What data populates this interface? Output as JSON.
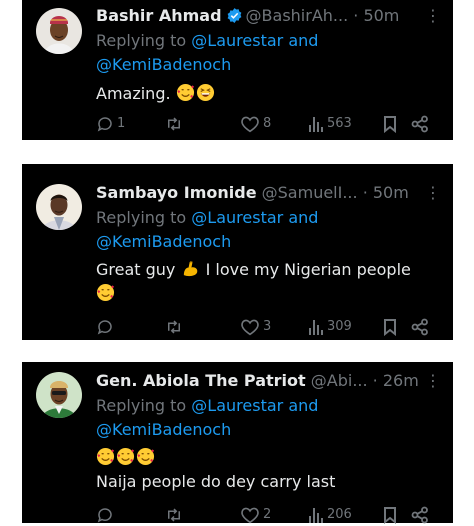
{
  "tweets": [
    {
      "name": "Bashir Ahmad",
      "verified": true,
      "handle": "@BashirAh...",
      "time": "· 50m",
      "replying_prefix": "Replying to",
      "replying_to_1": "@Laurestar",
      "replying_and": "and",
      "replying_to_2": "@KemiBadenoch",
      "text_line_1": "Amazing.",
      "emoji_line_1": [
        "smiling-face-with-hearts",
        "grinning-squinting-face"
      ],
      "replies": "1",
      "retweets": "",
      "likes": "8",
      "views": "563"
    },
    {
      "name": "Sambayo Imonide",
      "verified": false,
      "handle": "@SamuelI...",
      "time": "· 50m",
      "replying_prefix": "Replying to",
      "replying_to_1": "@Laurestar",
      "replying_and": "and",
      "replying_to_2": "@KemiBadenoch",
      "text_line_1a": "Great guy",
      "text_line_1b": "I love my Nigerian people",
      "emoji_line_1": [
        "flexed-biceps"
      ],
      "emoji_line_2": [
        "smiling-face-with-hearts"
      ],
      "replies": "",
      "retweets": "",
      "likes": "3",
      "views": "309"
    },
    {
      "name": "Gen. Abiola The Patriot",
      "verified": false,
      "handle": "@Abi...",
      "time": "· 26m",
      "replying_prefix": "Replying to",
      "replying_to_1": "@Laurestar",
      "replying_and": "and",
      "replying_to_2": "@KemiBadenoch",
      "emoji_line_1": [
        "smiling-face-with-hearts",
        "smiling-face-with-hearts",
        "smiling-face-with-hearts"
      ],
      "text_line_2": "Naija people do dey carry last",
      "replies": "",
      "retweets": "",
      "likes": "2",
      "views": "206"
    }
  ],
  "colors": {
    "background": "#000000",
    "text": "#e7e9ea",
    "muted": "#71767b",
    "link": "#1d9bf0",
    "verified": "#1d9bf0"
  }
}
